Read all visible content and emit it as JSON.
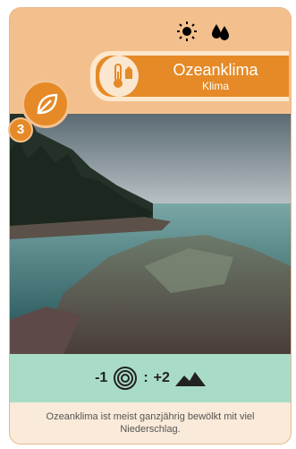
{
  "card": {
    "title": "Ozeanklima",
    "subtitle": "Klima",
    "badge_number": "3",
    "description": "Ozeanklima ist meist ganzjährig bewölkt mit viel Niederschlag.",
    "icons": [
      "sun-icon",
      "drop-icon",
      "thermometer-icon",
      "leaf-icon",
      "ring-icon",
      "mountain-icon"
    ],
    "formula": {
      "left": "-1",
      "separator": ":",
      "right": "+2"
    }
  },
  "colors": {
    "header": "#f3c08d",
    "title_bar": "#e58a27",
    "formula_band": "#a9dcc6"
  }
}
